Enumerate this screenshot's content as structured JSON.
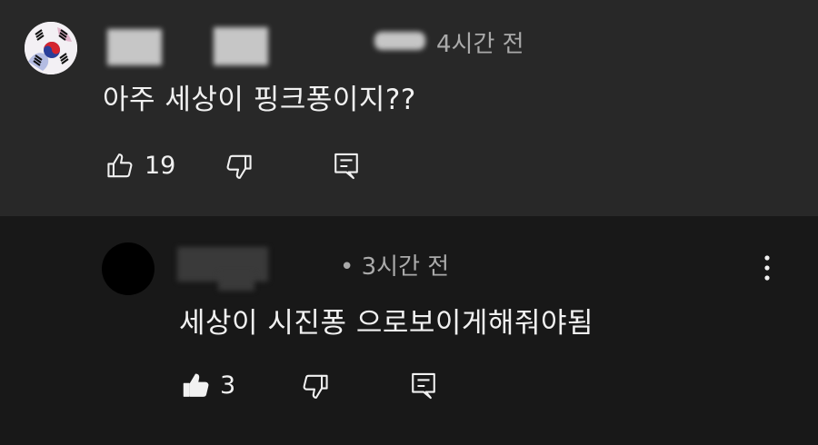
{
  "comments": [
    {
      "time": "4시간 전",
      "text": "아주 세상이 핑크퐁이지??",
      "likes": "19",
      "icons": {
        "like": "thumb-up-outline-icon",
        "dislike": "thumb-down-outline-icon",
        "reply": "reply-icon",
        "avatar": "korean-flag-avatar"
      }
    },
    {
      "time": "• 3시간 전",
      "text": "세상이 시진퐁 으로보이게해줘야됨",
      "likes": "3",
      "icons": {
        "like": "thumb-up-filled-icon",
        "dislike": "thumb-down-outline-icon",
        "reply": "reply-icon",
        "more": "more-vertical-icon"
      }
    }
  ],
  "colors": {
    "top_bg": "#282828",
    "reply_bg": "#181818",
    "text": "#f1f1f1",
    "secondary": "#aaaaaa"
  }
}
